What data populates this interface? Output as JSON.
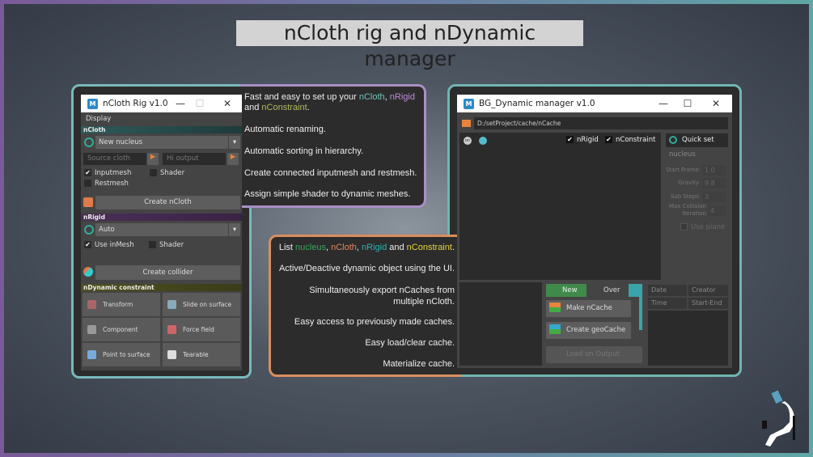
{
  "title": "nCloth rig and nDynamic manager",
  "colors": {
    "ncloth_teal": "#6fc5c0",
    "nrigid_purple": "#c48ad8",
    "nconstraint_olive": "#b3b85e",
    "nucleus_green": "#3aa65a",
    "ncloth_orange": "#e0875a",
    "nrigid_teal": "#2ab3b3",
    "nconstraint_yellow": "#e8d23a"
  },
  "left_features": {
    "intro": {
      "pre": "Fast and easy to set up your ",
      "a": "nCloth",
      "sep": ", ",
      "b": "nRigid",
      "and": " and ",
      "c": "nConstraint",
      "end": "."
    },
    "items": [
      "Automatic renaming.",
      "Automatic sorting in hierarchy.",
      "Create connected inputmesh and restmesh.",
      "Assign simple shader to dynamic meshes."
    ]
  },
  "right_features": {
    "intro": {
      "pre": "List ",
      "a": "nucleus",
      "s1": ", ",
      "b": "nCloth",
      "s2": ", ",
      "c": "nRigid",
      "and": " and ",
      "d": "nConstraint",
      "end": "."
    },
    "items": [
      "Active/Deactive dynamic object using the UI.",
      "Simultaneously export nCaches from multiple nCloth.",
      "Easy access to previously made caches.",
      "Easy load/clear cache.",
      "Materialize cache."
    ]
  },
  "rig": {
    "window_title": "nCloth Rig v1.0",
    "logo": "M",
    "menu": "Display",
    "ncloth_section": "nCloth",
    "nucleus_select": "New nucleus",
    "source_placeholder": "Source cloth",
    "hi_placeholder": "Hi output",
    "inputmesh": "Inputmesh",
    "inputmesh_checked": true,
    "shader": "Shader",
    "restmesh": "Restmesh",
    "create_ncloth": "Create nCloth",
    "nrigid_section": "nRigid",
    "rigid_select": "Auto",
    "use_inmesh": "Use inMesh",
    "rigid_shader": "Shader",
    "create_collider": "Create collider",
    "constraint_section": "nDynamic constraint",
    "constraints": [
      "Transform",
      "Slide on surface",
      "Component",
      "Force field",
      "Point to surface",
      "Tearable"
    ]
  },
  "manager": {
    "window_title": "BG_Dynamic manager v1.0",
    "logo": "M",
    "path": "D:/setProject/cache/nCache",
    "nrigid": "nRigid",
    "nconstraint": "nConstraint",
    "quick_set": "Quick set",
    "nucleus": "nucleus",
    "settings": [
      {
        "label": "Start Frame",
        "value": "1.0"
      },
      {
        "label": "Gravity",
        "value": "9.8"
      },
      {
        "label": "Sub Steps",
        "value": "3"
      },
      {
        "label": "Max Collision Iteration",
        "value": "4"
      }
    ],
    "use_plane": "Use plane",
    "new": "New",
    "over": "Over",
    "make_ncache": "Make nCache",
    "create_geocache": "Create geoCache",
    "load_on_output": "Load on Output",
    "columns": [
      "Date",
      "Creator",
      "Time",
      "Start-End"
    ]
  }
}
